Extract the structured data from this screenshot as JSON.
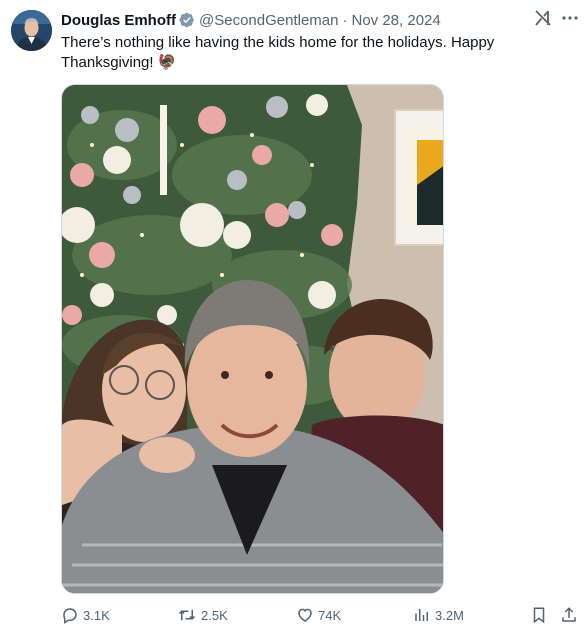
{
  "author": {
    "name": "Douglas Emhoff",
    "handle": "@SecondGentleman",
    "separator": "·",
    "date": "Nov 28, 2024",
    "verified": true,
    "verified_color": "#829aab"
  },
  "tweet": {
    "text": "There’s nothing like having the kids home for the holidays. Happy Thanksgiving!",
    "emoji": "🦃"
  },
  "media": {
    "type": "photo",
    "subject": "selfie of three people in front of a decorated Christmas tree"
  },
  "actions": {
    "replies": "3.1K",
    "reposts": "2.5K",
    "likes": "74K",
    "views": "3.2M"
  },
  "icons": [
    "grok-icon",
    "reply-icon",
    "repost-icon",
    "like-icon",
    "views-icon",
    "bookmark-icon",
    "share-icon",
    "verified-badge-icon"
  ],
  "colors": {
    "text": "#0f1419",
    "secondary_text": "#536471",
    "border": "#cfd9de"
  }
}
